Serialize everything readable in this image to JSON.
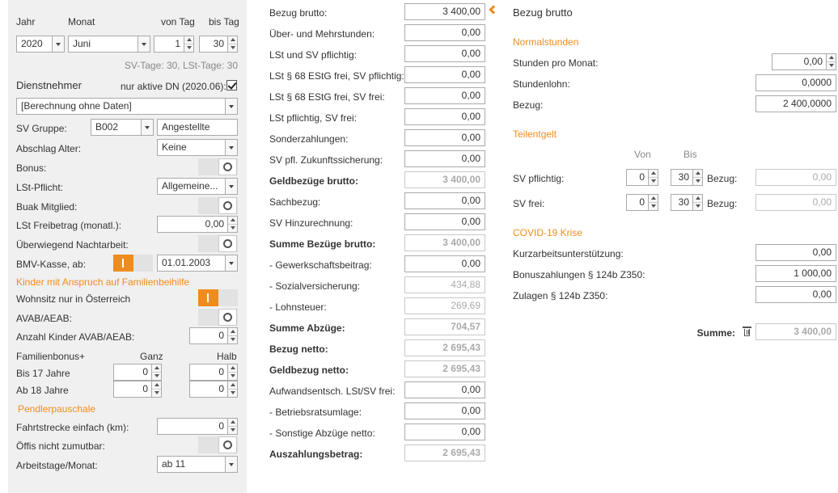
{
  "left": {
    "hdr_jahr": "Jahr",
    "hdr_monat": "Monat",
    "hdr_von_tag": "von Tag",
    "hdr_bis_tag": "bis Tag",
    "jahr": "2020",
    "monat": "Juni",
    "von_tag": "1",
    "bis_tag": "30",
    "tage_info": "SV-Tage: 30, LSt-Tage: 30",
    "dienstnehmer": "Dienstnehmer",
    "nur_aktive": "nur aktive DN (2020.06):",
    "berechnung": "[Berechnung ohne Daten]",
    "sv_gruppe_label": "SV Gruppe:",
    "sv_gruppe_code": "B002",
    "sv_gruppe_name": "Angestellte",
    "abschlag_label": "Abschlag Alter:",
    "abschlag_value": "Keine",
    "bonus_label": "Bonus:",
    "lst_pflicht_label": "LSt-Pflicht:",
    "lst_pflicht_value": "Allgemeine...",
    "buak_label": "Buak Mitglied:",
    "freibetrag_label": "LSt Freibetrag (monatl.):",
    "freibetrag_value": "0,00",
    "nacht_label": "Überwiegend Nachtarbeit:",
    "bmv_label": "BMV-Kasse, ab:",
    "bmv_date": "01.01.2003",
    "kinder_header": "Kinder mit Anspruch auf Familienbeihilfe",
    "wohnsitz_label": "Wohnsitz nur in Österreich",
    "avab_label": "AVAB/AEAB:",
    "anzahl_kinder_label": "Anzahl Kinder AVAB/AEAB:",
    "anzahl_kinder_value": "0",
    "famb_label": "Familienbonus+",
    "famb_ganz": "Ganz",
    "famb_halb": "Halb",
    "bis17_label": "Bis 17 Jahre",
    "bis17_ganz": "0",
    "bis17_halb": "0",
    "ab18_label": "Ab 18 Jahre",
    "ab18_ganz": "0",
    "ab18_halb": "0",
    "pendler_header": "Pendlerpauschale",
    "fahrtstrecke_label": "Fahrtstrecke einfach (km):",
    "fahrtstrecke_value": "0",
    "oeffis_label": "Öffis nicht zumutbar:",
    "arbeitstage_label": "Arbeitstage/Monat:",
    "arbeitstage_value": "ab 11"
  },
  "middle": [
    {
      "label": "Bezug brutto:",
      "value": "3 400,00",
      "bold": false,
      "disabled": false
    },
    {
      "label": "Über- und Mehrstunden:",
      "value": "0,00",
      "bold": false,
      "disabled": false
    },
    {
      "label": "LSt und SV pflichtig:",
      "value": "0,00",
      "bold": false,
      "disabled": false
    },
    {
      "label": "LSt § 68 EStG frei, SV pflichtig:",
      "value": "0,00",
      "bold": false,
      "disabled": false
    },
    {
      "label": "LSt § 68 EStG frei, SV frei:",
      "value": "0,00",
      "bold": false,
      "disabled": false
    },
    {
      "label": "LSt pflichtig, SV frei:",
      "value": "0,00",
      "bold": false,
      "disabled": false
    },
    {
      "label": "Sonderzahlungen:",
      "value": "0,00",
      "bold": false,
      "disabled": false
    },
    {
      "label": "SV pfl. Zukunftssicherung:",
      "value": "0,00",
      "bold": false,
      "disabled": false
    },
    {
      "label": "Geldbezüge brutto:",
      "value": "3 400,00",
      "bold": true,
      "disabled": true
    },
    {
      "label": "Sachbezug:",
      "value": "0,00",
      "bold": false,
      "disabled": false
    },
    {
      "label": "SV Hinzurechnung:",
      "value": "0,00",
      "bold": false,
      "disabled": false
    },
    {
      "label": "Summe Bezüge brutto:",
      "value": "3 400,00",
      "bold": true,
      "disabled": true
    },
    {
      "label": "- Gewerkschaftsbeitrag:",
      "value": "0,00",
      "bold": false,
      "disabled": false
    },
    {
      "label": "- Sozialversicherung:",
      "value": "434,88",
      "bold": false,
      "disabled": true
    },
    {
      "label": "- Lohnsteuer:",
      "value": "269,69",
      "bold": false,
      "disabled": true
    },
    {
      "label": "Summe Abzüge:",
      "value": "704,57",
      "bold": true,
      "disabled": true
    },
    {
      "label": "Bezug netto:",
      "value": "2 695,43",
      "bold": true,
      "disabled": true
    },
    {
      "label": "Geldbezug netto:",
      "value": "2 695,43",
      "bold": true,
      "disabled": true
    },
    {
      "label": "Aufwandsentsch. LSt/SV frei:",
      "value": "0,00",
      "bold": false,
      "disabled": false
    },
    {
      "label": "- Betriebsratsumlage:",
      "value": "0,00",
      "bold": false,
      "disabled": false
    },
    {
      "label": "- Sonstige Abzüge netto:",
      "value": "0,00",
      "bold": false,
      "disabled": false
    },
    {
      "label": "Auszahlungsbetrag:",
      "value": "2 695,43",
      "bold": true,
      "disabled": true
    }
  ],
  "right": {
    "title": "Bezug brutto",
    "normal_header": "Normalstunden",
    "stunden_label": "Stunden pro Monat:",
    "stunden_value": "0,00",
    "stundenlohn_label": "Stundenlohn:",
    "stundenlohn_value": "0,0000",
    "bezug_label": "Bezug:",
    "bezug_value": "2 400,0000",
    "teil_header": "Teilentgelt",
    "von_label": "Von",
    "bis_label": "Bis",
    "svpfl_label": "SV pflichtig:",
    "svpfl_von": "0",
    "svpfl_bis": "30",
    "svpfl_bezug_label": "Bezug:",
    "svpfl_bezug": "0,00",
    "svfrei_label": "SV frei:",
    "svfrei_von": "0",
    "svfrei_bis": "30",
    "svfrei_bezug_label": "Bezug:",
    "svfrei_bezug": "0,00",
    "covid_header": "COVID-19 Krise",
    "kurzarbeit_label": "Kurzarbeitsunterstützung:",
    "kurzarbeit_value": "0,00",
    "bonuszahl_label": "Bonuszahlungen § 124b Z350:",
    "bonuszahl_value": "1 000,00",
    "zulagen_label": "Zulagen § 124b Z350:",
    "zulagen_value": "0,00",
    "summe_label": "Summe:",
    "summe_value": "3 400,00"
  },
  "icons": {
    "active_row": "chevron-left-icon",
    "delete": "trash-icon"
  },
  "colors": {
    "accent": "#f08c1e",
    "panel_bg": "#f0f0f0"
  }
}
